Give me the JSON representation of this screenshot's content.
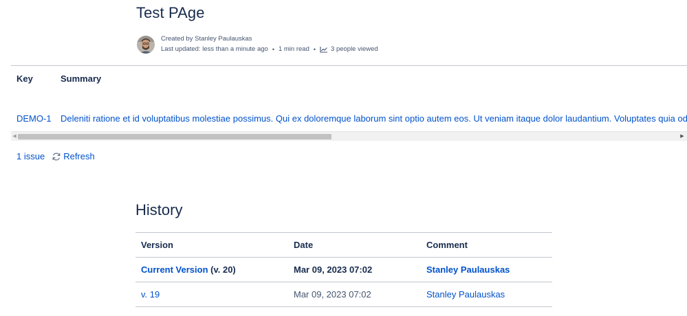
{
  "page": {
    "title": "Test PAge"
  },
  "byline": {
    "created_by": "Created by Stanley Paulauskas",
    "last_updated": "Last updated: less than a minute ago",
    "read_time": "1 min read",
    "views": "3 people viewed",
    "separator": "•"
  },
  "jira": {
    "headers": {
      "key": "Key",
      "summary": "Summary"
    },
    "rows": [
      {
        "key": "DEMO-1",
        "summary": "Deleniti ratione et id voluptatibus molestiae possimus. Qui ex doloremque laborum sint optio autem eos. Ut veniam itaque dolor laudantium. Voluptates quia odit"
      }
    ],
    "issue_count": "1 issue",
    "refresh_label": "Refresh"
  },
  "history": {
    "title": "History",
    "headers": {
      "version": "Version",
      "date": "Date",
      "comment": "Comment"
    },
    "rows": [
      {
        "version_link": "Current Version",
        "version_suffix": " (v. 20)",
        "date": "Mar 09, 2023 07:02",
        "comment": "Stanley Paulauskas"
      },
      {
        "version_link": "v. 19",
        "version_suffix": "",
        "date": "Mar 09, 2023 07:02",
        "comment": "Stanley Paulauskas"
      }
    ]
  },
  "colors": {
    "link": "#0052cc",
    "text": "#172b4d",
    "border": "#c1c7d0"
  },
  "icons": {
    "avatar": "user-avatar",
    "views": "line-chart-icon",
    "refresh": "refresh-icon"
  }
}
